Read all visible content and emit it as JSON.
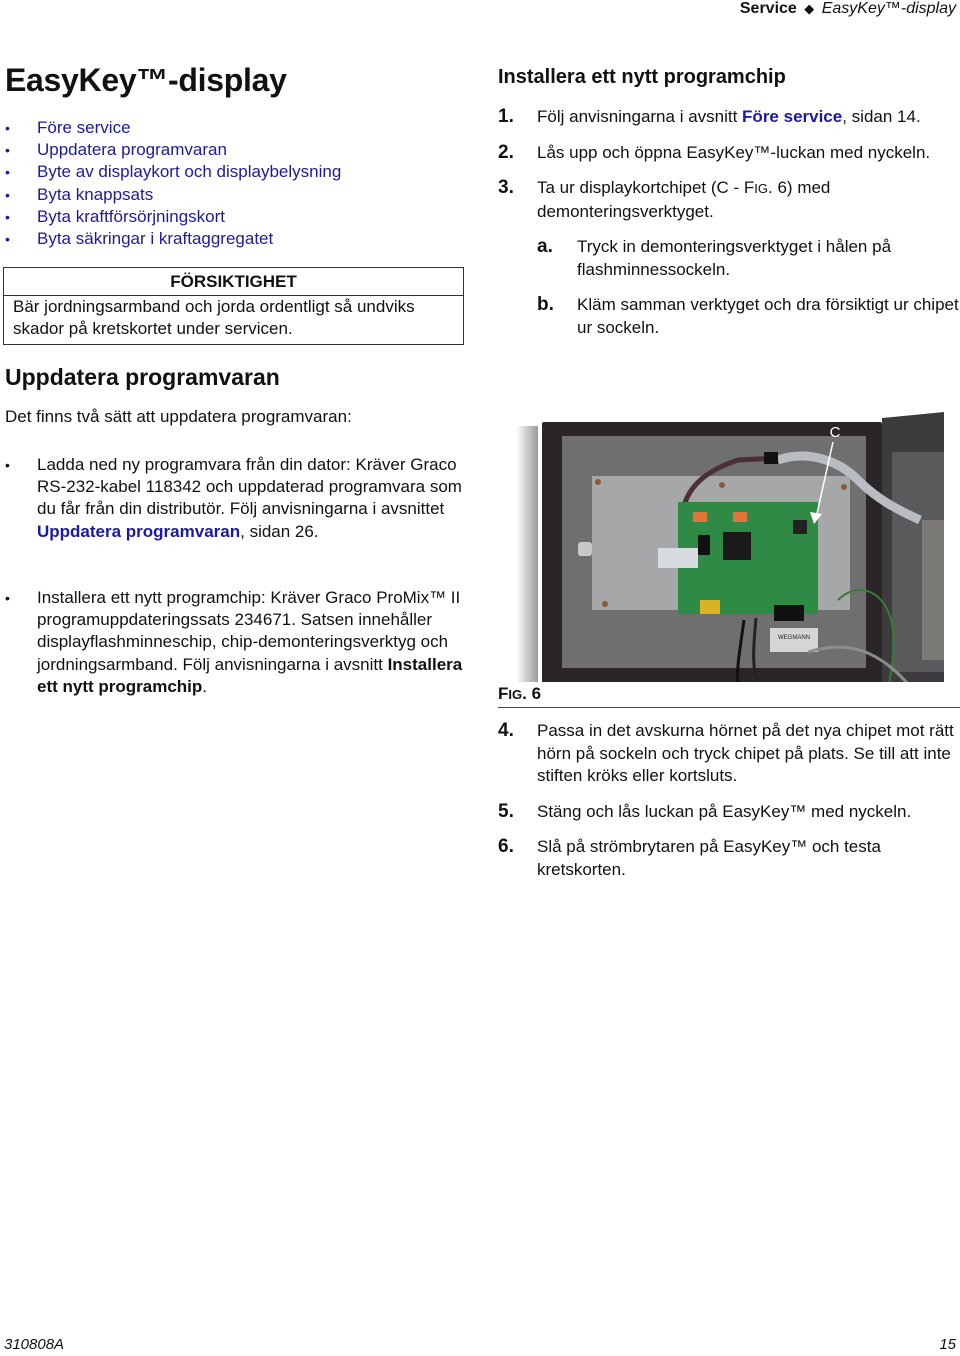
{
  "running_header": {
    "section": "Service",
    "separator_icon": "diamond",
    "chapter": "EasyKey™-display"
  },
  "page_title": "EasyKey™-display",
  "toc": [
    "Före service",
    "Uppdatera programvaran",
    "Byte av displaykort och displaybelysning",
    "Byta knappsats",
    "Byta kraftförsörjningskort",
    "Byta säkringar i kraftaggregatet"
  ],
  "caution": {
    "title": "FÖRSIKTIGHET",
    "line1": "Bär jordningsarmband och jorda ordentligt så undviks",
    "line2": "skador på kretskortet under servicen."
  },
  "update_section": {
    "heading": "Uppdatera programvaran",
    "intro": "Det finns två sätt att uppdatera programvaran:",
    "option1": {
      "text": "Ladda ned ny programvara från din dator: Kräver Graco RS-232-kabel 118342 och uppdaterad programvara som du får från din distributör. Följ anvisningarna i avsnittet ",
      "link": "Uppdatera programvaran",
      "suffix": ", sidan 26."
    },
    "option2": {
      "text": "Installera ett nytt programchip: Kräver Graco ProMix™ II programuppdateringssats 234671. Satsen innehåller displayflashminneschip, chip-demonteringsverktyg och jordningsarmband. Följ anvisningarna i avsnitt ",
      "bold": "Installera ett nytt programchip",
      "suffix": "."
    }
  },
  "install_section": {
    "heading": "Installera ett nytt programchip",
    "steps": [
      {
        "num": "1.",
        "text": "Följ anvisningarna i avsnitt ",
        "link": "Före service",
        "suffix": ", sidan 14."
      },
      {
        "num": "2.",
        "text": "Lås upp och öppna EasyKey™-luckan med nyckeln."
      },
      {
        "num": "3.",
        "text": "Ta ur displaykortchipet (C - F",
        "fig_sc": "IG",
        "suffix": ". 6) med demonteringsverktyget."
      }
    ],
    "substeps": [
      {
        "num": "a.",
        "text": "Tryck in demonteringsverktyget i hålen på flashminnessockeln."
      },
      {
        "num": "b.",
        "text": "Kläm samman verktyget och dra försiktigt ur chipet ur sockeln."
      }
    ],
    "steps_after": [
      {
        "num": "4.",
        "text": "Passa in det avskurna hörnet på det nya chipet mot rätt hörn på sockeln och tryck chipet på plats. Se till att inte stiften kröks eller kortsluts."
      },
      {
        "num": "5.",
        "text": "Stäng och lås luckan på EasyKey™ med nyckeln."
      },
      {
        "num": "6.",
        "text": "Slå på strömbrytaren på EasyKey™ och testa kretskorten."
      }
    ]
  },
  "figure": {
    "callout": "C",
    "label_prefix": "F",
    "label_sc": "IG",
    "label_num": ". 6",
    "nameplate": "WEGMANN"
  },
  "footer": {
    "doc_number": "310808A",
    "page_number": "15"
  }
}
